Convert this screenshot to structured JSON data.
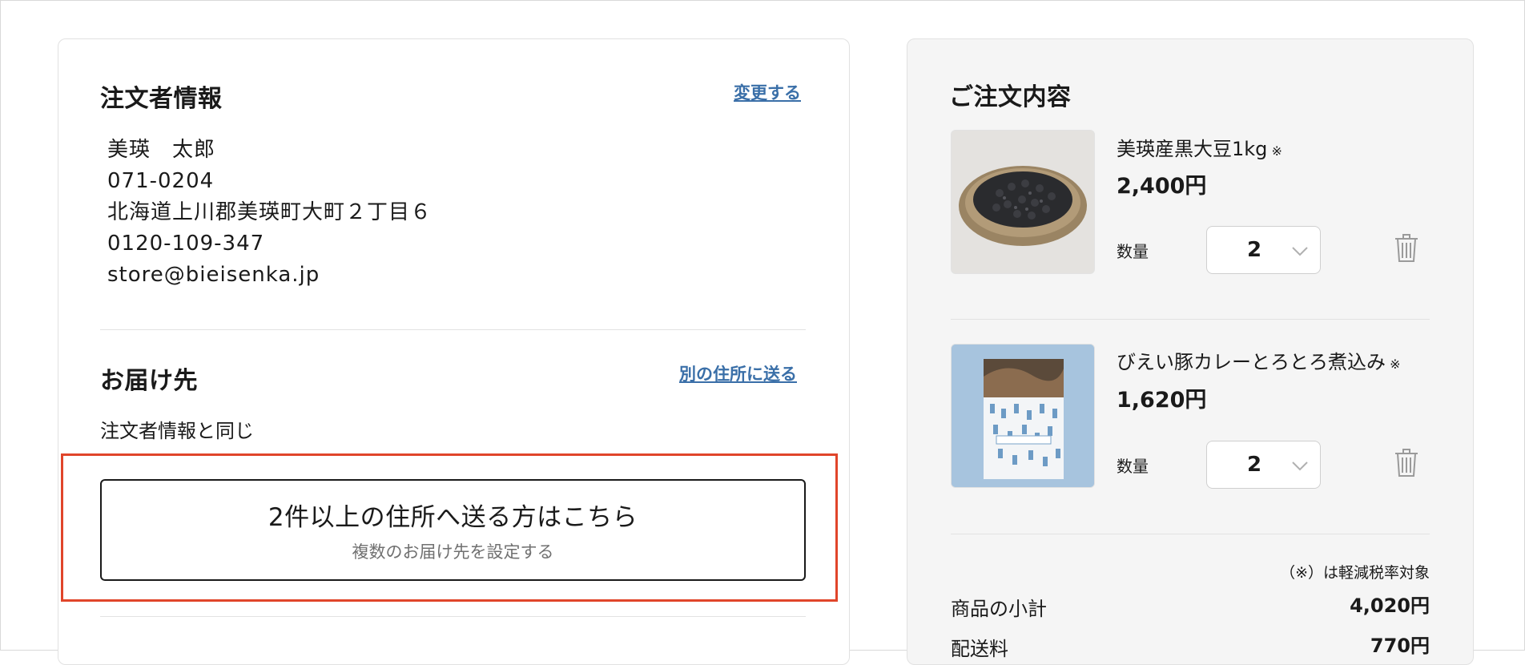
{
  "orderer": {
    "title": "注文者情報",
    "change_link": "変更する",
    "name": "美瑛　太郎",
    "postal": "071-0204",
    "address": "北海道上川郡美瑛町大町２丁目６",
    "phone": "0120-109-347",
    "email": "store@bieisenka.jp"
  },
  "delivery": {
    "title": "お届け先",
    "other_address_link": "別の住所に送る",
    "same_as_orderer": "注文者情報と同じ",
    "multi_button_main": "2件以上の住所へ送る方はこちら",
    "multi_button_sub": "複数のお届け先を設定する"
  },
  "order_summary": {
    "title": "ご注文内容",
    "items": [
      {
        "name": "美瑛産黒大豆1kg",
        "mark": "※",
        "price": "2,400円",
        "qty_label": "数量",
        "qty": "2",
        "image": "black-soybeans-basket"
      },
      {
        "name": "びえい豚カレーとろとろ煮込み",
        "mark": "※",
        "price": "1,620円",
        "qty_label": "数量",
        "qty": "2",
        "image": "curry-package"
      }
    ],
    "tax_note": "（※）は軽減税率対象",
    "subtotal_label": "商品の小計",
    "subtotal_value": "4,020円",
    "shipping_label": "配送料",
    "shipping_value": "770円"
  },
  "colors": {
    "link": "#3a6fa8",
    "highlight": "#e0452a",
    "summary_bg": "#f5f5f5"
  }
}
